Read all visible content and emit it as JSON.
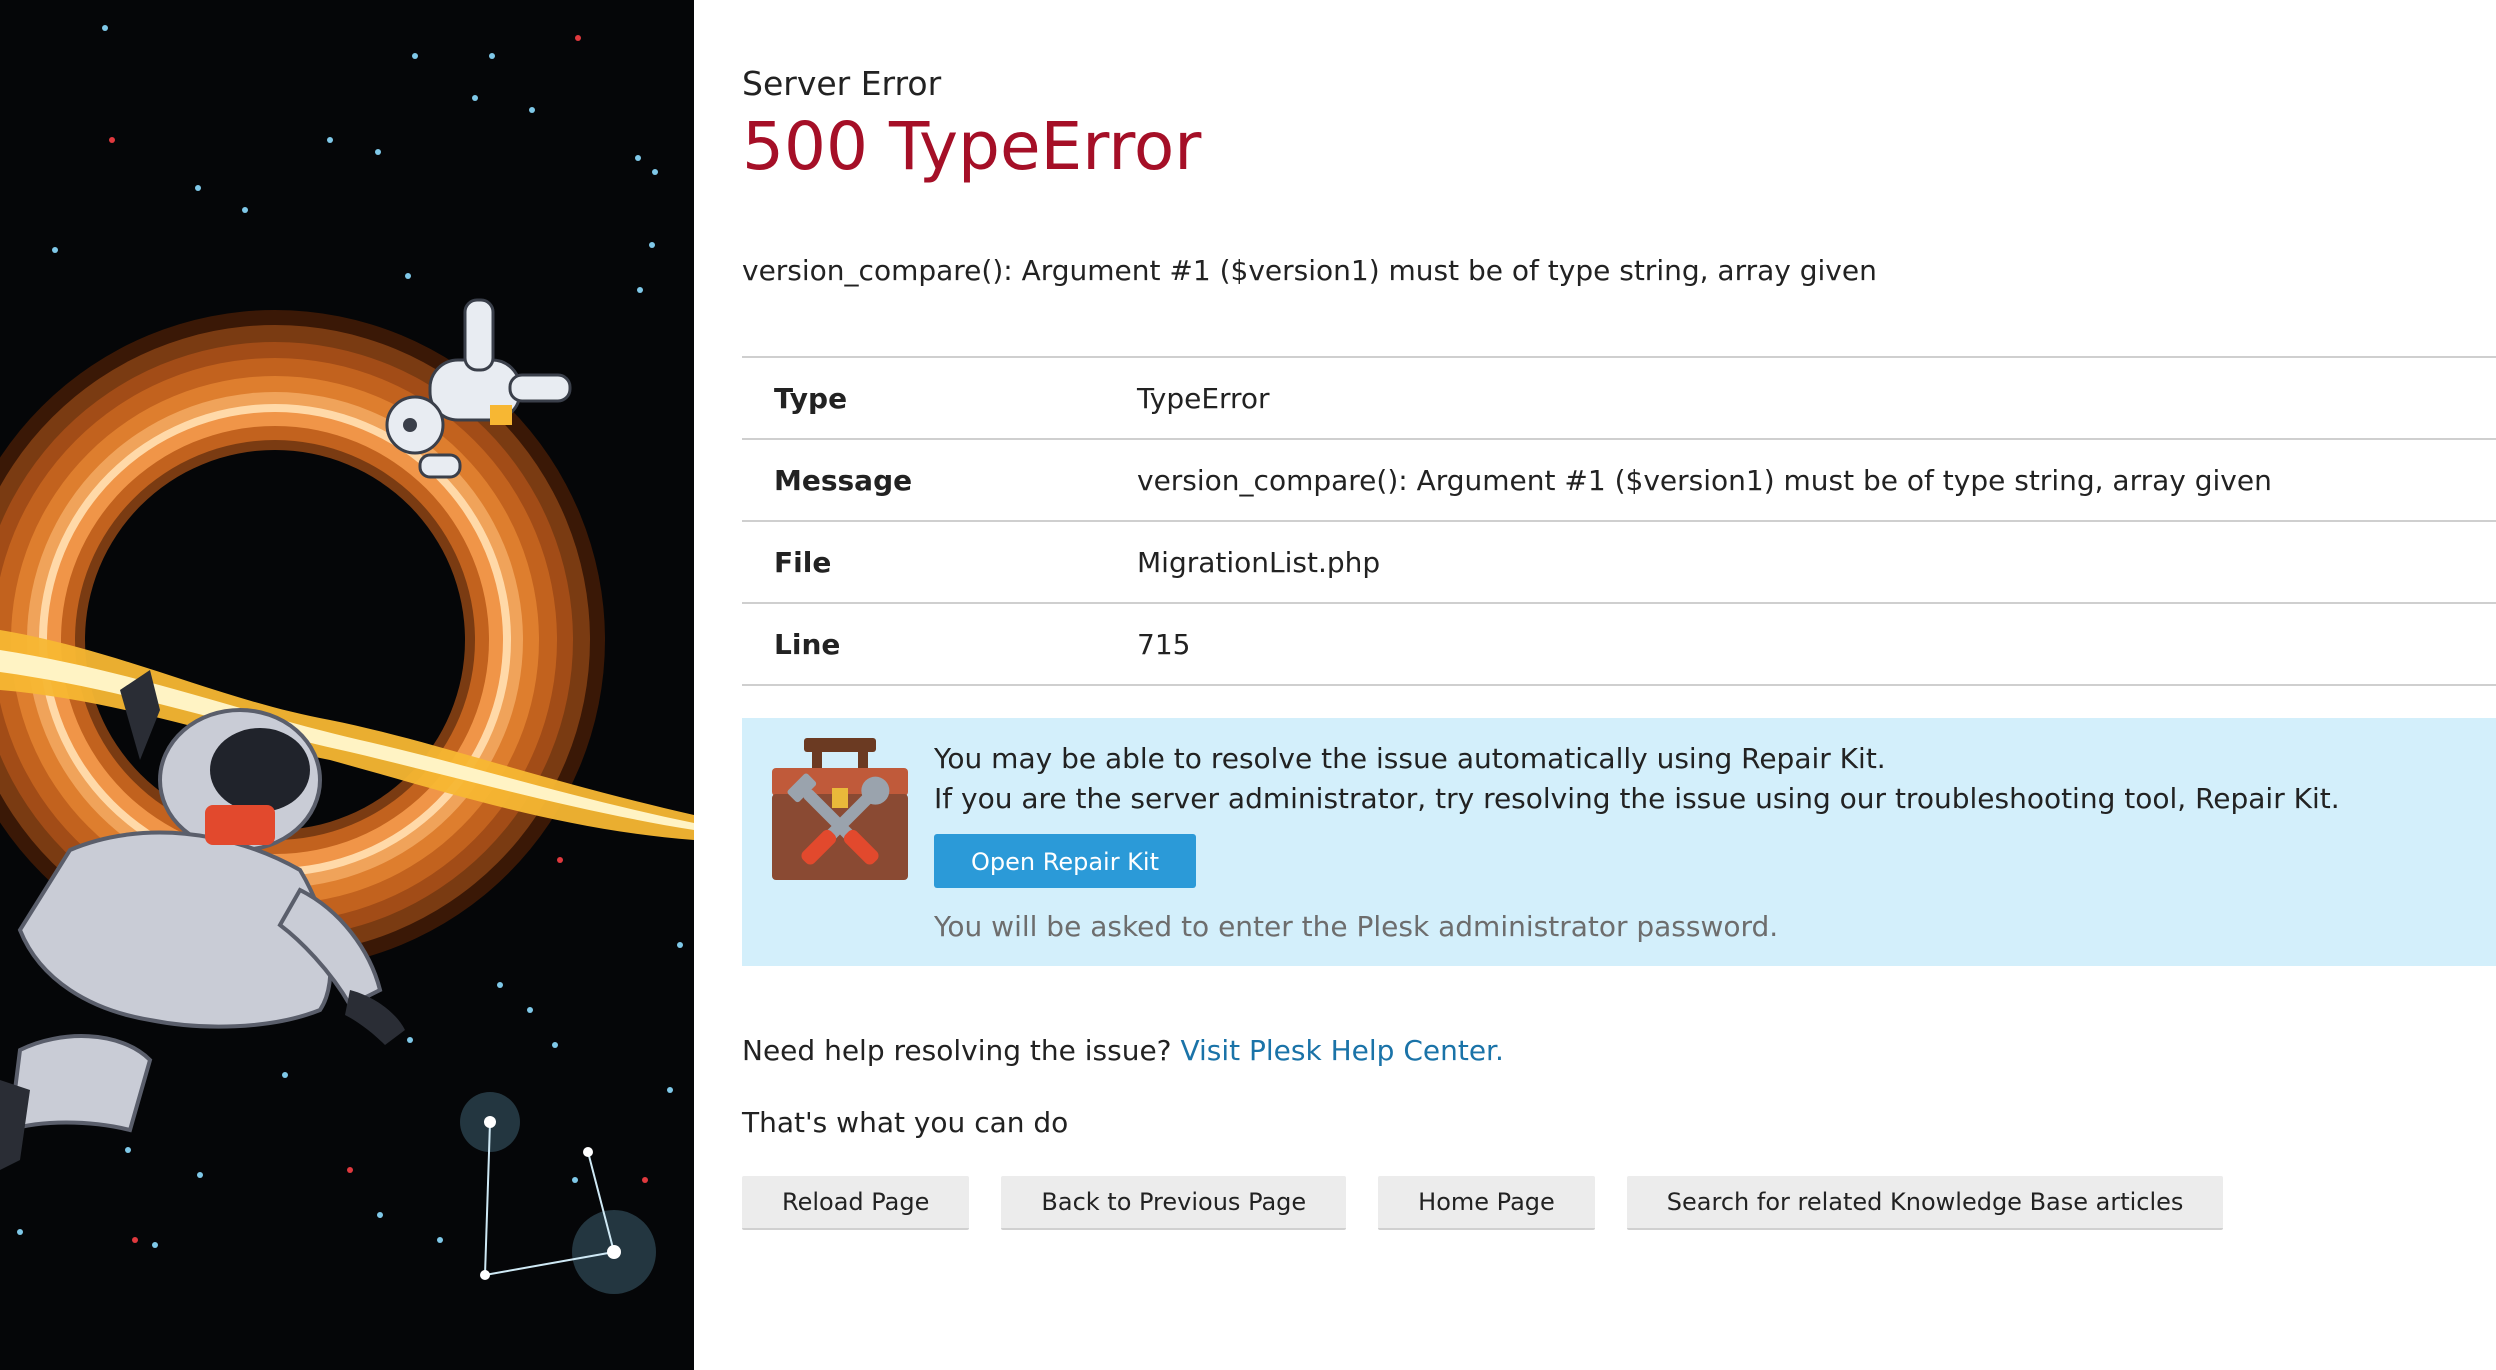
{
  "header": {
    "subtitle": "Server Error",
    "title": "500 TypeError"
  },
  "error": {
    "summary": "version_compare(): Argument #1 ($version1) must be of type string, array given",
    "details": [
      {
        "key": "Type",
        "value": "TypeError"
      },
      {
        "key": "Message",
        "value": "version_compare(): Argument #1 ($version1) must be of type string, array given"
      },
      {
        "key": "File",
        "value": "MigrationList.php"
      },
      {
        "key": "Line",
        "value": "715"
      }
    ]
  },
  "repair_kit": {
    "line1": "You may be able to resolve the issue automatically using Repair Kit.",
    "line2": "If you are the server administrator, try resolving the issue using our troubleshooting tool, Repair Kit.",
    "button_label": "Open Repair Kit",
    "hint": "You will be asked to enter the Plesk administrator password.",
    "icon": "toolbox-icon"
  },
  "help": {
    "prefix": "Need help resolving the issue?",
    "link_label": "Visit Plesk Help Center."
  },
  "actions": {
    "heading": "That's what you can do",
    "buttons": [
      {
        "label": "Reload Page"
      },
      {
        "label": "Back to Previous Page"
      },
      {
        "label": "Home Page"
      },
      {
        "label": "Search for related Knowledge Base articles"
      }
    ]
  },
  "illustration": {
    "icon": "astronaut-space-illustration",
    "colors": {
      "background": "#050608",
      "ring_outer": "#7a3b12",
      "ring_mid": "#c2621e",
      "ring_inner": "#f0a35a",
      "ring_core": "#ffd9a8",
      "flame": "#f7b733"
    }
  },
  "colors": {
    "title": "#a50f27",
    "link": "#1a73a8",
    "repair_bg": "#d3effb",
    "primary_button": "#2b9ad8",
    "secondary_button": "#ececec"
  }
}
